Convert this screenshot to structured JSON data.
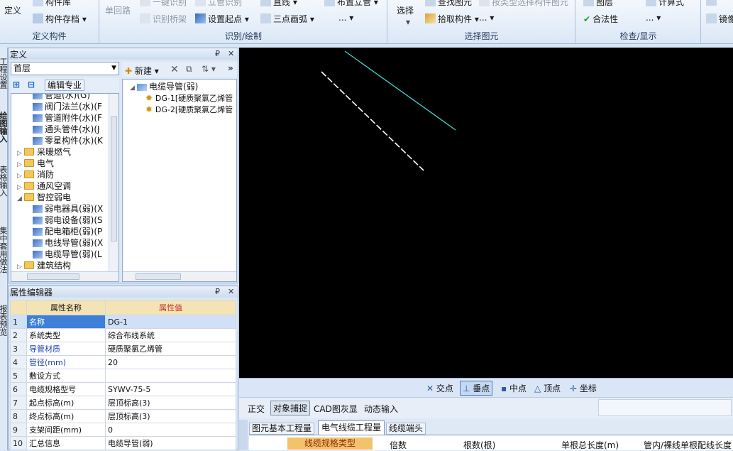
{
  "ribbon": {
    "groups": [
      {
        "label": "定义构件",
        "items": [
          "定义",
          "构件库",
          "构件存档"
        ]
      },
      {
        "label": "识别/绘制",
        "items": [
          "单回路",
          "一键识别",
          "识别桥架",
          "立管识别",
          "设置起点",
          "直线",
          "三点画弧",
          "布置立管"
        ]
      },
      {
        "label": "选择图元",
        "items": [
          "选择",
          "查找图元",
          "拾取构件",
          "按类型选择构件图元"
        ]
      },
      {
        "label": "检查/显示",
        "items": [
          "图层",
          "合法性",
          "计算式"
        ]
      },
      {
        "label": "",
        "items": [
          "镜像"
        ]
      }
    ]
  },
  "left_tabs": [
    "工程设置",
    "绘图输入",
    "表格输入",
    "集中套用做法",
    "报表预览"
  ],
  "define_panel": {
    "title": "定义",
    "floor": "首层",
    "edit_specialty": "编辑专业",
    "tree": [
      {
        "label": "管道(水)(G)",
        "indent": 2
      },
      {
        "label": "阀门法兰(水)(F",
        "indent": 2
      },
      {
        "label": "管道附件(水)(F",
        "indent": 2
      },
      {
        "label": "通头管件(水)(J",
        "indent": 2
      },
      {
        "label": "零星构件(水)(K",
        "indent": 2
      },
      {
        "label": "采暖燃气",
        "indent": 1
      },
      {
        "label": "电气",
        "indent": 1
      },
      {
        "label": "消防",
        "indent": 1
      },
      {
        "label": "通风空调",
        "indent": 1
      },
      {
        "label": "智控弱电",
        "indent": 1
      },
      {
        "label": "弱电器具(弱)(X",
        "indent": 2
      },
      {
        "label": "弱电设备(弱)(S",
        "indent": 2
      },
      {
        "label": "配电箱柜(弱)(P",
        "indent": 2
      },
      {
        "label": "电线导管(弱)(X",
        "indent": 2
      },
      {
        "label": "电缆导管(弱)(L",
        "indent": 2
      },
      {
        "label": "建筑结构",
        "indent": 1
      }
    ],
    "new_button": "新建",
    "component_tree": {
      "root": "电缆导管(弱)",
      "children": [
        "DG-1[硬质聚氯乙烯管",
        "DG-2[硬质聚氯乙烯管"
      ]
    }
  },
  "property_panel": {
    "title": "属性编辑器",
    "col_name": "属性名称",
    "col_value": "属性值",
    "rows": [
      {
        "no": "1",
        "name": "名称",
        "value": "DG-1",
        "blue": true
      },
      {
        "no": "2",
        "name": "系统类型",
        "value": "综合布线系统",
        "blue": false
      },
      {
        "no": "3",
        "name": "导管材质",
        "value": "硬质聚氯乙烯管",
        "blue": true
      },
      {
        "no": "4",
        "name": "管径(mm)",
        "value": "20",
        "blue": true
      },
      {
        "no": "5",
        "name": "敷设方式",
        "value": "",
        "blue": false
      },
      {
        "no": "6",
        "name": "电缆规格型号",
        "value": "SYWV-75-5",
        "blue": false
      },
      {
        "no": "7",
        "name": "起点标高(m)",
        "value": "层顶标高(3)",
        "blue": false
      },
      {
        "no": "8",
        "name": "终点标高(m)",
        "value": "层顶标高(3)",
        "blue": false
      },
      {
        "no": "9",
        "name": "支架间距(mm)",
        "value": "0",
        "blue": false
      },
      {
        "no": "10",
        "name": "汇总信息",
        "value": "电缆导管(弱)",
        "blue": false
      }
    ]
  },
  "snap_bar": [
    "交点",
    "垂点",
    "中点",
    "顶点",
    "坐标"
  ],
  "status_bar": [
    "正交",
    "对象捕捉",
    "CAD图灰显",
    "动态输入"
  ],
  "bottom_tabs": [
    "图元基本工程量",
    "电气线缆工程量",
    "线缆端头"
  ],
  "bottom_columns": [
    "线缆规格类型",
    "倍数",
    "根数(根)",
    "单根总长度(m)",
    "管内/裸线单根配线长度"
  ],
  "colors": {
    "accent": "#3d7fd9",
    "canvas": "#000000",
    "line_cyan": "#3fd6c8",
    "line_white": "#ffffff"
  }
}
